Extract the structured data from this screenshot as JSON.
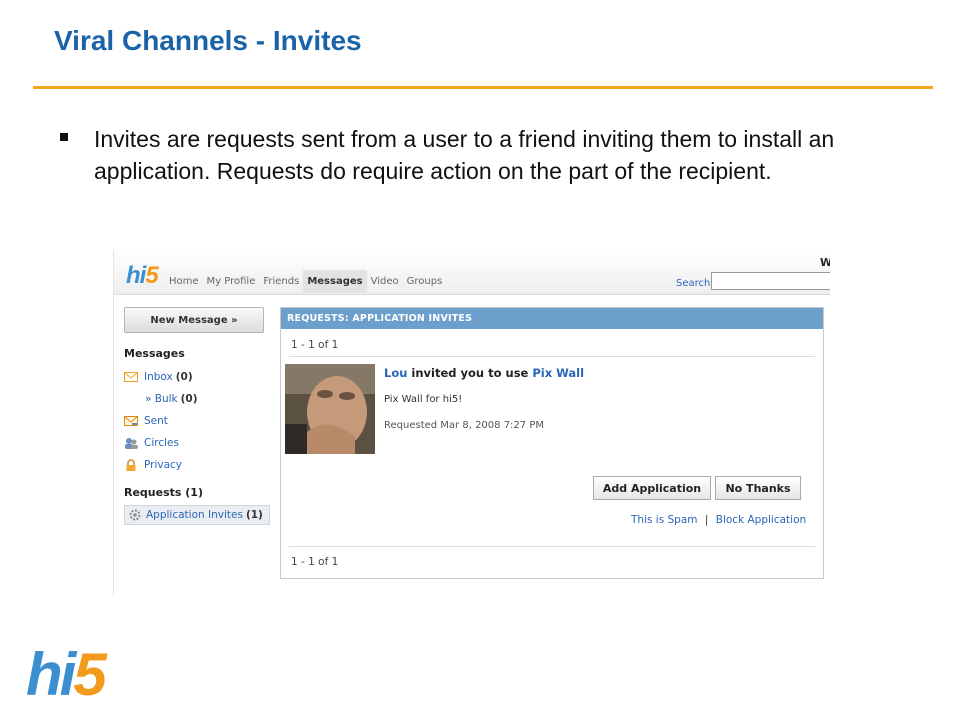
{
  "slide": {
    "title": "Viral Channels - Invites",
    "bullet": "Invites are requests sent from a user to a friend inviting them to install an application. Requests do require action on the part of the recipient.",
    "footer_logo": {
      "h": "hi",
      "n": "5"
    }
  },
  "colors": {
    "title": "#1a63a8",
    "rule": "#f2a81d",
    "link": "#2a66b8",
    "header_bar": "#6c9fcc"
  },
  "screenshot": {
    "logo": {
      "h": "hi",
      "n": "5"
    },
    "corner_letter": "W",
    "nav": [
      "Home",
      "My Profile",
      "Friends",
      "Messages",
      "Video",
      "Groups"
    ],
    "nav_active": "Messages",
    "search": {
      "label": "Search",
      "value": ""
    },
    "sidebar": {
      "new_message": "New Message »",
      "messages_heading": "Messages",
      "items": [
        {
          "label": "Inbox",
          "count": "(0)",
          "icon": "envelope-icon"
        },
        {
          "label": "» Bulk",
          "count": "(0)",
          "icon": ""
        },
        {
          "label": "Sent",
          "count": "",
          "icon": "sent-envelope-icon"
        },
        {
          "label": "Circles",
          "count": "",
          "icon": "people-icon"
        },
        {
          "label": "Privacy",
          "count": "",
          "icon": "lock-icon"
        }
      ],
      "requests_heading": "Requests (1)",
      "request_item": {
        "label": "Application Invites",
        "count": "(1)",
        "icon": "gear-icon"
      }
    },
    "panel": {
      "header": "REQUESTS: APPLICATION INVITES",
      "pager_top": "1 - 1 of 1",
      "pager_bottom": "1 - 1 of 1",
      "invite": {
        "sender": "Lou",
        "middle": " invited you to use ",
        "app": "Pix Wall",
        "description": "Pix Wall for hi5!",
        "requested": "Requested Mar 8, 2008 7:27 PM"
      },
      "buttons": {
        "add": "Add Application",
        "decline": "No Thanks"
      },
      "links": {
        "spam": "This is Spam",
        "separator": "|",
        "block": "Block Application"
      }
    }
  }
}
